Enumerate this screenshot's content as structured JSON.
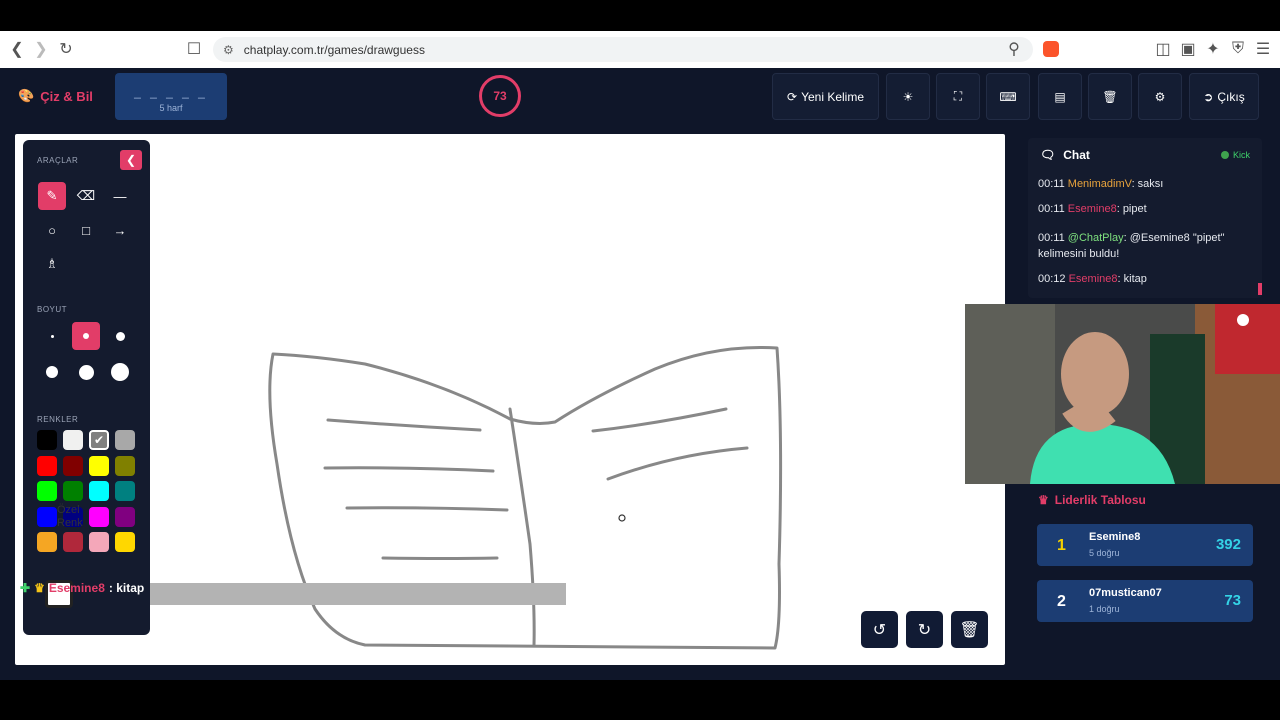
{
  "browser": {
    "url": "chatplay.com.tr/games/drawguess"
  },
  "header": {
    "logo_text": "Çiz & Bil",
    "word_mask": "_ _ _ _ _",
    "word_length": "5 harf",
    "timer": "73",
    "new_word_label": "Yeni Kelime",
    "exit_label": "Çıkış"
  },
  "tools": {
    "section_tools": "ARAÇLAR",
    "section_size": "BOYUT",
    "section_colors": "RENKLER",
    "custom_color": "Özel\nRenk",
    "colors": [
      "#000000",
      "#f0f0f0",
      "#808080",
      "#a8a8a8",
      "#ff0000",
      "#800000",
      "#ffff00",
      "#808000",
      "#00ff00",
      "#008000",
      "#00ffff",
      "#008080",
      "#0000ff",
      "#000080",
      "#ff00ff",
      "#800080",
      "#f5a623",
      "#b0283b",
      "#f4a7b9",
      "#ffd700"
    ]
  },
  "guess_overlay": {
    "name": "Esemine8",
    "text": ": kitap"
  },
  "chat": {
    "title": "Chat",
    "platform": "Kick",
    "messages": [
      {
        "time": "00:11",
        "user": "MenimadimV",
        "color": "#e8a33c",
        "text": ": saksı"
      },
      {
        "time": "00:11",
        "user": "Esemine8",
        "color": "#e23d68",
        "text": ": pipet"
      },
      {
        "time": "00:11",
        "user": "@ChatPlay",
        "color": "#7ee07e",
        "text": ": @Esemine8 \"pipet\" kelimesini buldu!"
      },
      {
        "time": "00:12",
        "user": "Esemine8",
        "color": "#e23d68",
        "text": ": kitap"
      }
    ]
  },
  "leaderboard": {
    "title": "Liderlik Tablosu",
    "rows": [
      {
        "rank": "1",
        "name": "Esemine8",
        "sub": "5 doğru",
        "score": "392"
      },
      {
        "rank": "2",
        "name": "07mustican07",
        "sub": "1 doğru",
        "score": "73"
      }
    ]
  }
}
